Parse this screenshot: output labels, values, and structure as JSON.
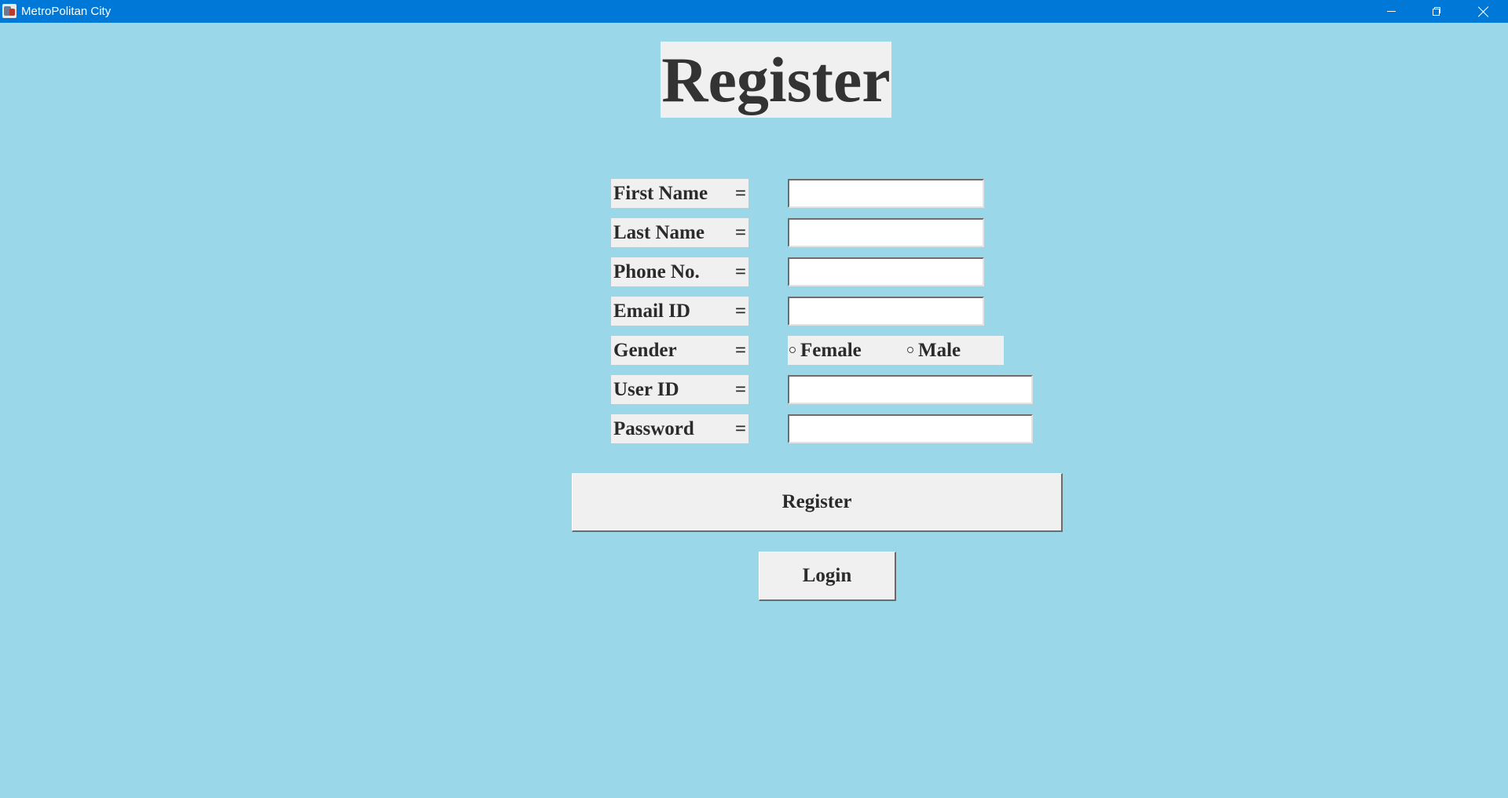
{
  "window": {
    "title": "MetroPolitan City",
    "icon": "app-icon",
    "controls": [
      "minimize-icon",
      "restore-icon",
      "close-icon"
    ]
  },
  "colors": {
    "background": "#9ad7e8",
    "titlebar": "#0078d7",
    "panel": "#f0f0f0",
    "text": "#2b2b2b"
  },
  "heading": "Register",
  "form": {
    "separator": "=",
    "first_name": {
      "label": "First Name",
      "value": ""
    },
    "last_name": {
      "label": "Last Name",
      "value": ""
    },
    "phone": {
      "label": "Phone No.",
      "value": ""
    },
    "email": {
      "label": "Email ID",
      "value": ""
    },
    "gender": {
      "label": "Gender",
      "options": [
        "Female",
        "Male"
      ],
      "selected": null
    },
    "user_id": {
      "label": "User ID",
      "value": ""
    },
    "password": {
      "label": "Password",
      "value": ""
    }
  },
  "buttons": {
    "register": "Register",
    "login": "Login"
  }
}
